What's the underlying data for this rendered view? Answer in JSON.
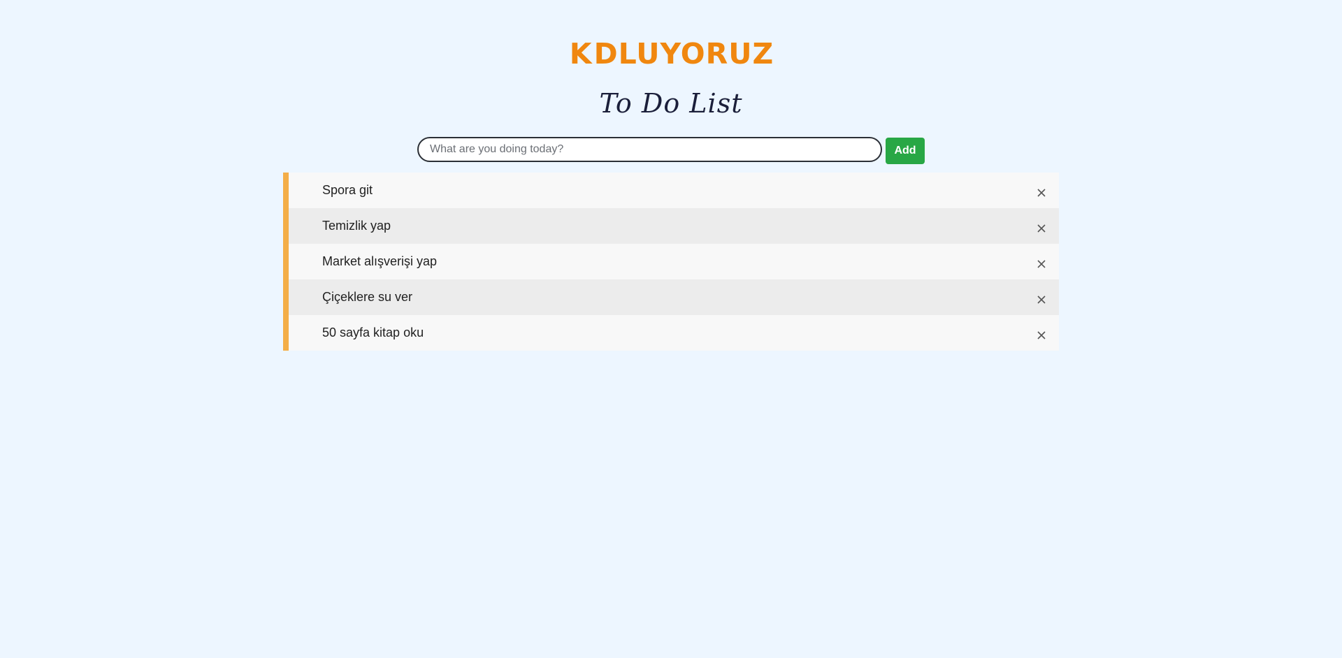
{
  "header": {
    "logo_text_before": "K",
    "logo_text_after": "DLUYORUZ",
    "logo_alt": "KODLUYORUZ",
    "title": "To Do List"
  },
  "form": {
    "placeholder": "What are you doing today?",
    "value": "",
    "add_label": "Add"
  },
  "todos": [
    {
      "text": "Spora git",
      "icon": "close-icon"
    },
    {
      "text": "Temizlik yap",
      "icon": "close-icon"
    },
    {
      "text": "Market alışverişi yap",
      "icon": "close-icon"
    },
    {
      "text": "Çiçeklere su ver",
      "icon": "close-icon"
    },
    {
      "text": "50 sayfa kitap oku",
      "icon": "close-icon"
    }
  ],
  "colors": {
    "background": "#edf6ff",
    "brand": "#f0870f",
    "accent_border": "#f4ae48",
    "add_button": "#28a745"
  }
}
